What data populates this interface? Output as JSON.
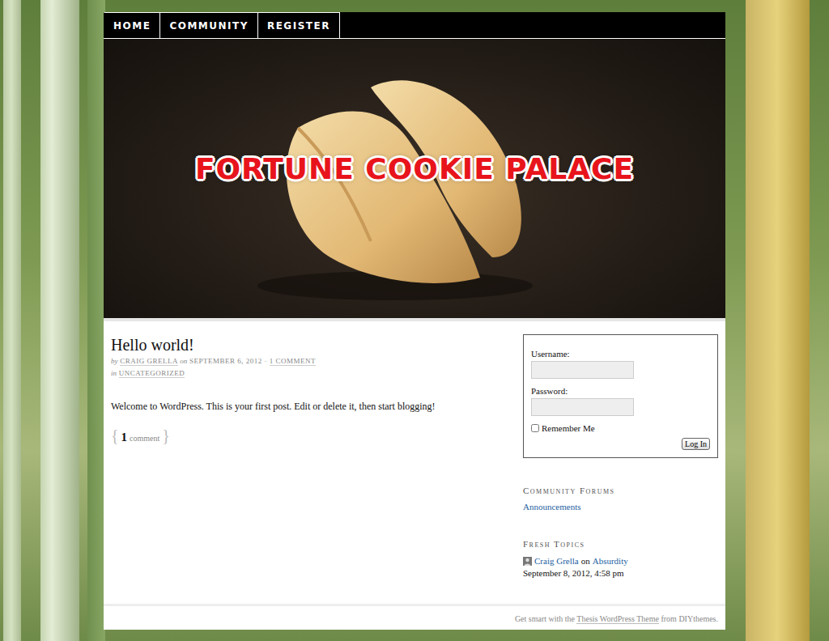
{
  "nav": [
    {
      "label": "HOME",
      "selected": false
    },
    {
      "label": "COMMUNITY",
      "selected": false
    },
    {
      "label": "REGISTER",
      "selected": false
    }
  ],
  "header": {
    "title": "FORTUNE COOKIE PALACE"
  },
  "post": {
    "title": "Hello world!",
    "by": "by",
    "author": "CRAIG GRELLA",
    "on": "on",
    "date": "SEPTEMBER 6, 2012",
    "separator": "·",
    "comments": "1 COMMENT",
    "category_prefix": "in",
    "category": "UNCATEGORIZED",
    "body": "Welcome to WordPress. This is your first post. Edit or delete it, then start blogging!",
    "comment_open": "{",
    "comment_count": "1",
    "comment_label": "comment",
    "comment_close": "}"
  },
  "login": {
    "username_label": "Username:",
    "username": "",
    "password_label": "Password:",
    "password": "",
    "remember_label": "Remember Me",
    "remember": false,
    "button": "Log In"
  },
  "sidebar": {
    "forums": {
      "heading": "Community Forums",
      "items": [
        "Announcements"
      ]
    },
    "fresh": {
      "heading": "Fresh Topics",
      "topics": [
        {
          "author": "Craig Grella",
          "on": "on",
          "topic": "Absurdity",
          "time": "September 8, 2012, 4:58 pm"
        }
      ]
    }
  },
  "footer": {
    "parts": [
      {
        "text": "Get smart with the ",
        "link": false
      },
      {
        "text": "Thesis WordPress Theme",
        "link": true
      },
      {
        "text": " from DIYthemes.",
        "link": false
      }
    ]
  }
}
